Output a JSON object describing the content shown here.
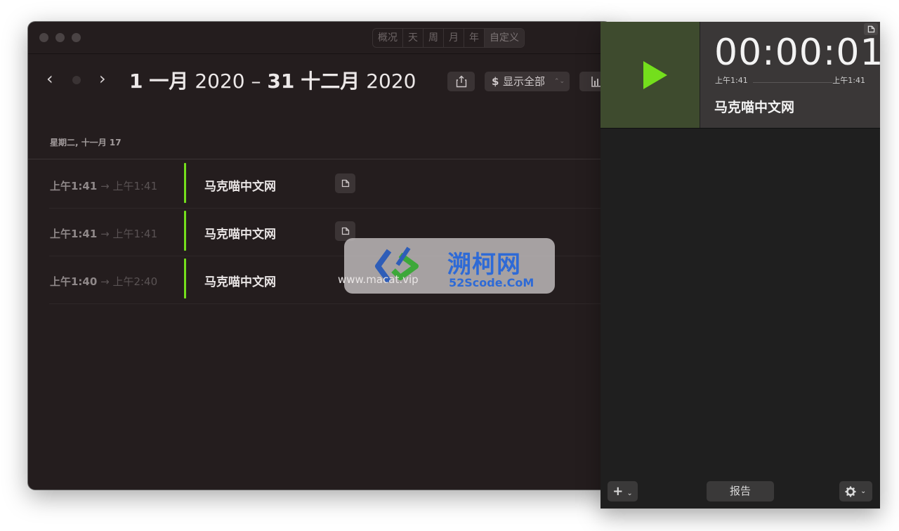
{
  "tabs": [
    "概况",
    "天",
    "周",
    "月",
    "年",
    "自定义"
  ],
  "header": {
    "start_day": "1",
    "start_month": "一月",
    "start_year": "2020",
    "dash": "–",
    "end_day": "31",
    "end_month": "十二月",
    "end_year": "2020",
    "prev": "‹",
    "next": "›"
  },
  "toolbar": {
    "currency_symbol": "$",
    "filter_label": "显示全部",
    "filter_chevron": "⌃⌄"
  },
  "list": {
    "date_header": "星期二, 十一月 17",
    "rows": [
      {
        "start": "上午1:41",
        "arrow": "→",
        "end": "上午1:41",
        "task": "马克喵中文网"
      },
      {
        "start": "上午1:41",
        "arrow": "→",
        "end": "上午1:41",
        "task": "马克喵中文网"
      },
      {
        "start": "上午1:40",
        "arrow": "→",
        "end": "上午2:40",
        "task": "马克喵中文网"
      }
    ]
  },
  "watermark": {
    "url": "www.macat.vip",
    "brand": "溯柯网",
    "code": "52Scode.CoM"
  },
  "timer": {
    "elapsed": "00:00:01",
    "start_time": "上午1:41",
    "end_time": "上午1:41",
    "task": "马克喵中文网"
  },
  "bottom": {
    "add_label": "+",
    "report_label": "报告",
    "chevron": "⌄"
  },
  "colors": {
    "accent_green": "#74df1c",
    "play_bg": "#3e4b2e"
  },
  "icons": {
    "share": "share-icon",
    "chart": "bar-chart-icon",
    "note": "note-icon",
    "play": "play-icon",
    "gear": "gear-icon"
  }
}
